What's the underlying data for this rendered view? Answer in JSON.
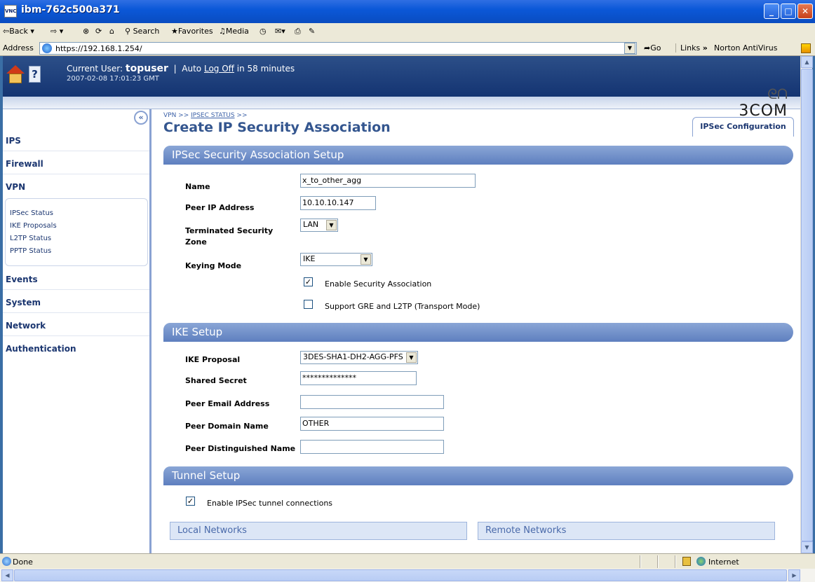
{
  "window": {
    "title": "ibm-762c500a371",
    "app_icon_text": "VNC"
  },
  "toolbar": {
    "back": "⇦Back ▾",
    "forward": "⇨ ▾",
    "search": "Search",
    "favorites": "Favorites",
    "media": "Media"
  },
  "addressbar": {
    "label": "Address",
    "url": "https://192.168.1.254/",
    "go": "Go",
    "links": "Links",
    "norton": "Norton AntiVirus"
  },
  "header": {
    "current_user_label": "Current User:",
    "user": "topuser",
    "auto_prefix": "Auto",
    "log_off": "Log Off",
    "auto_suffix": "in 58 minutes",
    "timestamp": "2007-02-08 17:01:23 GMT",
    "brand": "3COM"
  },
  "sidebar": {
    "items": [
      "IPS",
      "Firewall",
      "VPN",
      "Events",
      "System",
      "Network",
      "Authentication"
    ],
    "vpn_sub": [
      "IPSec Status",
      "IKE Proposals",
      "L2TP Status",
      "PPTP Status"
    ]
  },
  "main": {
    "breadcrumb_prefix": "VPN >>",
    "breadcrumb_link": "IPSEC STATUS",
    "breadcrumb_suffix": ">>",
    "title": "Create IP Security Association",
    "tab": "IPSec Configuration",
    "sa_setup": {
      "heading": "IPSec Security Association Setup",
      "name_label": "Name",
      "name_value": "x_to_other_agg",
      "peer_ip_label": "Peer IP Address",
      "peer_ip_value": "10.10.10.147",
      "zone_label_1": "Terminated Security",
      "zone_label_2": "Zone",
      "zone_value": "LAN",
      "keying_label": "Keying Mode",
      "keying_value": "IKE",
      "enable_sa_label": "Enable Security Association",
      "enable_sa_checked": "☑",
      "gre_label": "Support GRE and L2TP (Transport Mode)"
    },
    "ike_setup": {
      "heading": "IKE Setup",
      "proposal_label": "IKE Proposal",
      "proposal_value": "3DES-SHA1-DH2-AGG-PFS",
      "secret_label": "Shared Secret",
      "secret_value": "**************",
      "email_label": "Peer Email Address",
      "email_value": "",
      "domain_label": "Peer Domain Name",
      "domain_value": "OTHER",
      "dn_label": "Peer Distinguished Name",
      "dn_value": ""
    },
    "tunnel_setup": {
      "heading": "Tunnel Setup",
      "enable_label": "Enable IPSec tunnel connections",
      "local_networks": "Local Networks",
      "remote_networks": "Remote Networks"
    }
  },
  "statusbar": {
    "text": "Done",
    "zone": "Internet"
  },
  "colors": {
    "accent": "#34568f",
    "section_bar": "#6f8fca",
    "header_bg": "#1f4280"
  }
}
